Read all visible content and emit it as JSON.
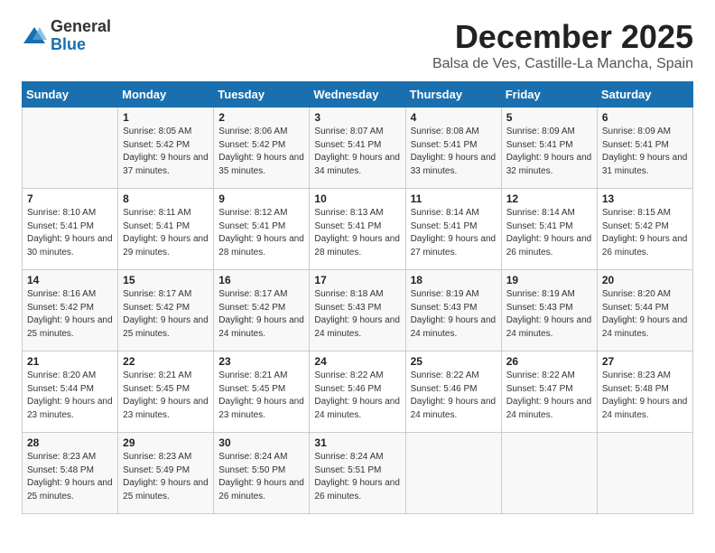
{
  "header": {
    "logo_general": "General",
    "logo_blue": "Blue",
    "month_title": "December 2025",
    "location": "Balsa de Ves, Castille-La Mancha, Spain"
  },
  "days_of_week": [
    "Sunday",
    "Monday",
    "Tuesday",
    "Wednesday",
    "Thursday",
    "Friday",
    "Saturday"
  ],
  "weeks": [
    [
      {
        "day": "",
        "info": ""
      },
      {
        "day": "1",
        "info": "Sunrise: 8:05 AM\nSunset: 5:42 PM\nDaylight: 9 hours\nand 37 minutes."
      },
      {
        "day": "2",
        "info": "Sunrise: 8:06 AM\nSunset: 5:42 PM\nDaylight: 9 hours\nand 35 minutes."
      },
      {
        "day": "3",
        "info": "Sunrise: 8:07 AM\nSunset: 5:41 PM\nDaylight: 9 hours\nand 34 minutes."
      },
      {
        "day": "4",
        "info": "Sunrise: 8:08 AM\nSunset: 5:41 PM\nDaylight: 9 hours\nand 33 minutes."
      },
      {
        "day": "5",
        "info": "Sunrise: 8:09 AM\nSunset: 5:41 PM\nDaylight: 9 hours\nand 32 minutes."
      },
      {
        "day": "6",
        "info": "Sunrise: 8:09 AM\nSunset: 5:41 PM\nDaylight: 9 hours\nand 31 minutes."
      }
    ],
    [
      {
        "day": "7",
        "info": "Sunrise: 8:10 AM\nSunset: 5:41 PM\nDaylight: 9 hours\nand 30 minutes."
      },
      {
        "day": "8",
        "info": "Sunrise: 8:11 AM\nSunset: 5:41 PM\nDaylight: 9 hours\nand 29 minutes."
      },
      {
        "day": "9",
        "info": "Sunrise: 8:12 AM\nSunset: 5:41 PM\nDaylight: 9 hours\nand 28 minutes."
      },
      {
        "day": "10",
        "info": "Sunrise: 8:13 AM\nSunset: 5:41 PM\nDaylight: 9 hours\nand 28 minutes."
      },
      {
        "day": "11",
        "info": "Sunrise: 8:14 AM\nSunset: 5:41 PM\nDaylight: 9 hours\nand 27 minutes."
      },
      {
        "day": "12",
        "info": "Sunrise: 8:14 AM\nSunset: 5:41 PM\nDaylight: 9 hours\nand 26 minutes."
      },
      {
        "day": "13",
        "info": "Sunrise: 8:15 AM\nSunset: 5:42 PM\nDaylight: 9 hours\nand 26 minutes."
      }
    ],
    [
      {
        "day": "14",
        "info": "Sunrise: 8:16 AM\nSunset: 5:42 PM\nDaylight: 9 hours\nand 25 minutes."
      },
      {
        "day": "15",
        "info": "Sunrise: 8:17 AM\nSunset: 5:42 PM\nDaylight: 9 hours\nand 25 minutes."
      },
      {
        "day": "16",
        "info": "Sunrise: 8:17 AM\nSunset: 5:42 PM\nDaylight: 9 hours\nand 24 minutes."
      },
      {
        "day": "17",
        "info": "Sunrise: 8:18 AM\nSunset: 5:43 PM\nDaylight: 9 hours\nand 24 minutes."
      },
      {
        "day": "18",
        "info": "Sunrise: 8:19 AM\nSunset: 5:43 PM\nDaylight: 9 hours\nand 24 minutes."
      },
      {
        "day": "19",
        "info": "Sunrise: 8:19 AM\nSunset: 5:43 PM\nDaylight: 9 hours\nand 24 minutes."
      },
      {
        "day": "20",
        "info": "Sunrise: 8:20 AM\nSunset: 5:44 PM\nDaylight: 9 hours\nand 24 minutes."
      }
    ],
    [
      {
        "day": "21",
        "info": "Sunrise: 8:20 AM\nSunset: 5:44 PM\nDaylight: 9 hours\nand 23 minutes."
      },
      {
        "day": "22",
        "info": "Sunrise: 8:21 AM\nSunset: 5:45 PM\nDaylight: 9 hours\nand 23 minutes."
      },
      {
        "day": "23",
        "info": "Sunrise: 8:21 AM\nSunset: 5:45 PM\nDaylight: 9 hours\nand 23 minutes."
      },
      {
        "day": "24",
        "info": "Sunrise: 8:22 AM\nSunset: 5:46 PM\nDaylight: 9 hours\nand 24 minutes."
      },
      {
        "day": "25",
        "info": "Sunrise: 8:22 AM\nSunset: 5:46 PM\nDaylight: 9 hours\nand 24 minutes."
      },
      {
        "day": "26",
        "info": "Sunrise: 8:22 AM\nSunset: 5:47 PM\nDaylight: 9 hours\nand 24 minutes."
      },
      {
        "day": "27",
        "info": "Sunrise: 8:23 AM\nSunset: 5:48 PM\nDaylight: 9 hours\nand 24 minutes."
      }
    ],
    [
      {
        "day": "28",
        "info": "Sunrise: 8:23 AM\nSunset: 5:48 PM\nDaylight: 9 hours\nand 25 minutes."
      },
      {
        "day": "29",
        "info": "Sunrise: 8:23 AM\nSunset: 5:49 PM\nDaylight: 9 hours\nand 25 minutes."
      },
      {
        "day": "30",
        "info": "Sunrise: 8:24 AM\nSunset: 5:50 PM\nDaylight: 9 hours\nand 26 minutes."
      },
      {
        "day": "31",
        "info": "Sunrise: 8:24 AM\nSunset: 5:51 PM\nDaylight: 9 hours\nand 26 minutes."
      },
      {
        "day": "",
        "info": ""
      },
      {
        "day": "",
        "info": ""
      },
      {
        "day": "",
        "info": ""
      }
    ]
  ]
}
